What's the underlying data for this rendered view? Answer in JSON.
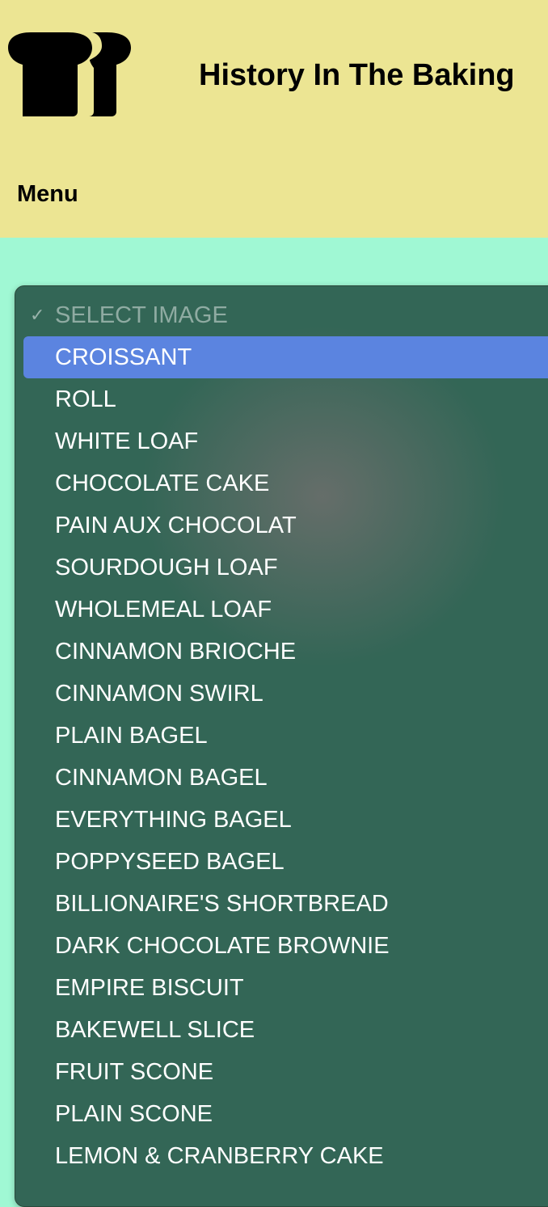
{
  "header": {
    "site_title": "History In The Baking",
    "logo_icon": "bread-loaf-icon",
    "menu_label": "Menu"
  },
  "dropdown": {
    "check_glyph": "✓",
    "placeholder": "SELECT IMAGE",
    "selected_index": 0,
    "options": [
      "CROISSANT",
      "ROLL",
      "WHITE LOAF",
      "CHOCOLATE CAKE",
      "PAIN AUX CHOCOLAT",
      "SOURDOUGH LOAF",
      "WHOLEMEAL LOAF",
      "CINNAMON BRIOCHE",
      "CINNAMON SWIRL",
      "PLAIN BAGEL",
      "CINNAMON BAGEL",
      "EVERYTHING BAGEL",
      "POPPYSEED BAGEL",
      "BILLIONAIRE'S SHORTBREAD",
      "DARK CHOCOLATE BROWNIE",
      "EMPIRE BISCUIT",
      "BAKEWELL SLICE",
      "FRUIT SCONE",
      "PLAIN SCONE",
      "LEMON & CRANBERRY CAKE"
    ]
  },
  "colors": {
    "header_bg": "#ece593",
    "page_bg": "#a0f8d4",
    "dropdown_bg": "#336656",
    "highlight": "#5b84e0",
    "text": "#ffffff"
  }
}
